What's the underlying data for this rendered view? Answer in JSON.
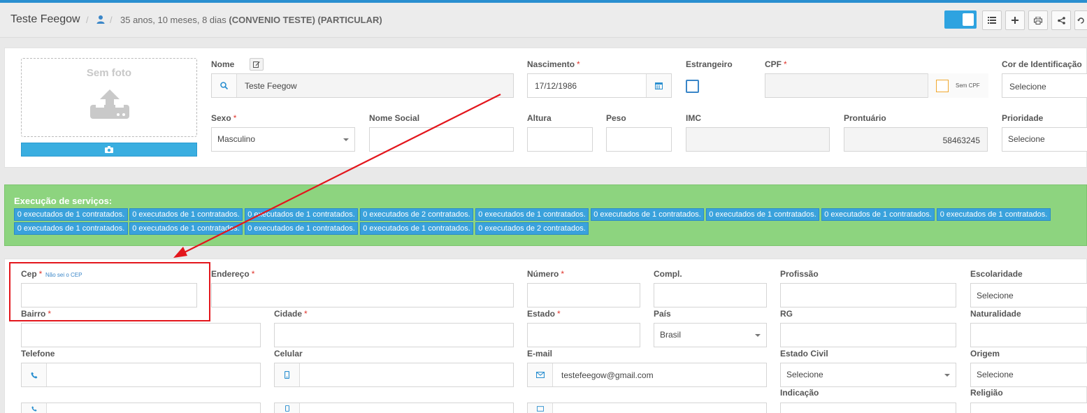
{
  "header": {
    "patient_name": "Teste Feegow",
    "age_text": "35 anos, 10 meses, 8 dias",
    "convenio": "(CONVENIO TESTE)",
    "tipo": "(PARTICULAR)"
  },
  "photo": {
    "label": "Sem foto"
  },
  "fields": {
    "nome": {
      "label": "Nome",
      "value": "Teste Feegow"
    },
    "nascimento": {
      "label": "Nascimento",
      "value": "17/12/1986"
    },
    "estrangeiro": {
      "label": "Estrangeiro"
    },
    "cpf": {
      "label": "CPF",
      "sem_cpf": "Sem CPF"
    },
    "cor": {
      "label": "Cor de Identificação",
      "value": "Selecione"
    },
    "sexo": {
      "label": "Sexo",
      "value": "Masculino"
    },
    "nome_social": {
      "label": "Nome Social"
    },
    "altura": {
      "label": "Altura"
    },
    "peso": {
      "label": "Peso"
    },
    "imc": {
      "label": "IMC"
    },
    "prontuario": {
      "label": "Prontuário",
      "value": "58463245"
    },
    "prioridade": {
      "label": "Prioridade",
      "value": "Selecione"
    },
    "cep": {
      "label": "Cep",
      "nao_sei": "Não sei o CEP"
    },
    "endereco": {
      "label": "Endereço"
    },
    "numero": {
      "label": "Número"
    },
    "compl": {
      "label": "Compl."
    },
    "profissao": {
      "label": "Profissão"
    },
    "escolaridade": {
      "label": "Escolaridade",
      "value": "Selecione"
    },
    "bairro": {
      "label": "Bairro"
    },
    "cidade": {
      "label": "Cidade"
    },
    "estado": {
      "label": "Estado"
    },
    "pais": {
      "label": "País",
      "value": "Brasil"
    },
    "rg": {
      "label": "RG"
    },
    "naturalidade": {
      "label": "Naturalidade"
    },
    "telefone": {
      "label": "Telefone"
    },
    "celular": {
      "label": "Celular"
    },
    "email": {
      "label": "E-mail",
      "value": "testefeegow@gmail.com"
    },
    "estado_civil": {
      "label": "Estado Civil",
      "value": "Selecione"
    },
    "origem": {
      "label": "Origem",
      "value": "Selecione"
    },
    "indicacao": {
      "label": "Indicação"
    },
    "religiao": {
      "label": "Religião"
    }
  },
  "services": {
    "title": "Execução de serviços:",
    "chips": [
      "0 executados de 1 contratados.",
      "0 executados de 1 contratados.",
      "0 executados de 1 contratados.",
      "0 executados de 2 contratados.",
      "0 executados de 1 contratados.",
      "0 executados de 1 contratados.",
      "0 executados de 1 contratados.",
      "0 executados de 1 contratados.",
      "0 executados de 1 contratados.",
      "0 executados de 1 contratados.",
      "0 executados de 1 contratados.",
      "0 executados de 1 contratados.",
      "0 executados de 1 contratados.",
      "0 executados de 2 contratados."
    ]
  },
  "colors": {
    "accent": "#2ea3e0",
    "green_panel": "#8dd47f",
    "required": "#e0352d",
    "highlight": "#e3161c"
  }
}
